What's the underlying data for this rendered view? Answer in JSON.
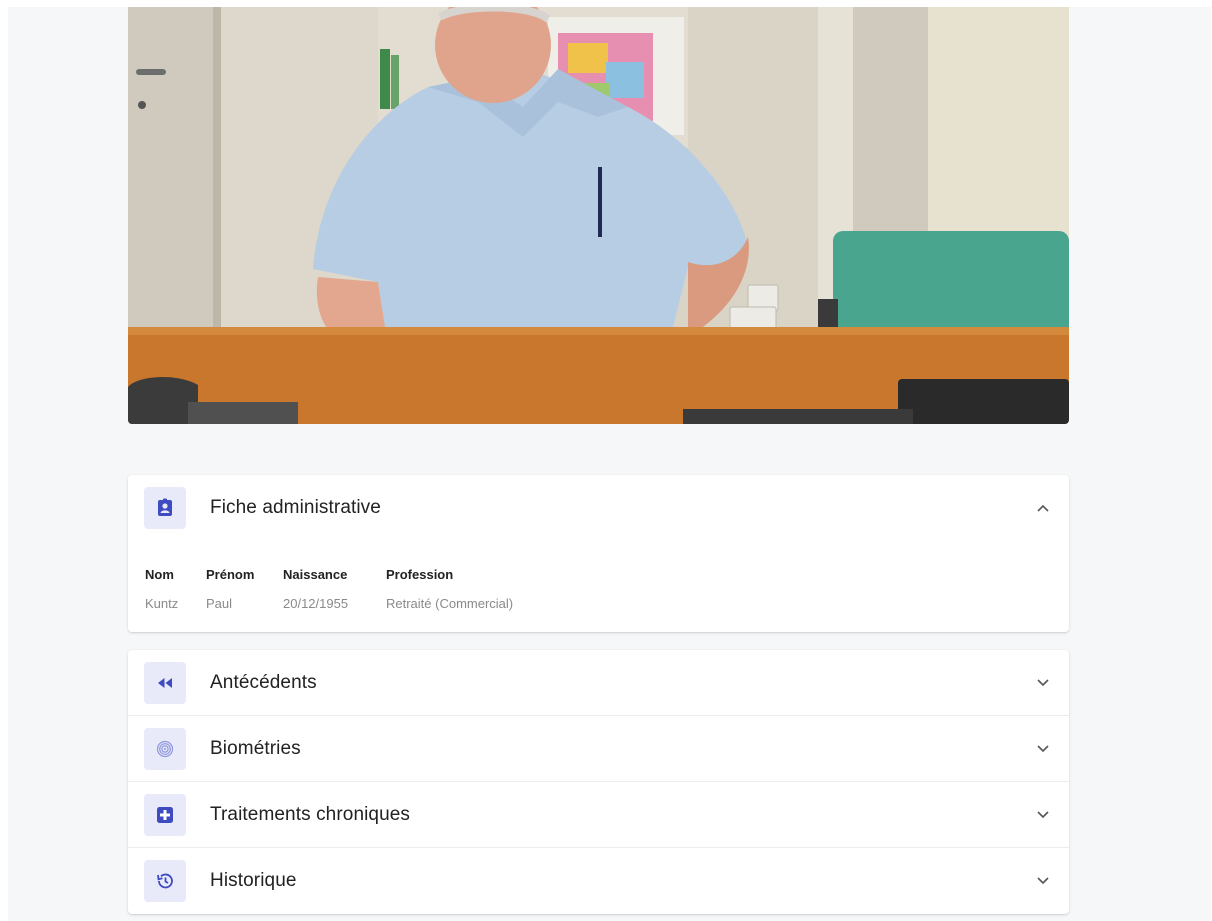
{
  "admin": {
    "title": "Fiche administrative",
    "icon": "contact-badge-icon",
    "expanded": true,
    "fields": [
      {
        "label": "Nom",
        "value": "Kuntz"
      },
      {
        "label": "Prénom",
        "value": "Paul"
      },
      {
        "label": "Naissance",
        "value": "20/12/1955"
      },
      {
        "label": "Profession",
        "value": "Retraité (Commercial)"
      }
    ]
  },
  "sections": [
    {
      "title": "Antécédents",
      "icon": "rewind-icon"
    },
    {
      "title": "Biométries",
      "icon": "fingerprint-icon"
    },
    {
      "title": "Traitements chroniques",
      "icon": "medical-plus-icon"
    },
    {
      "title": "Historique",
      "icon": "history-icon"
    }
  ],
  "colors": {
    "accent": "#3f4bc0",
    "icon_bg": "#e8eafa",
    "page_bg": "#f6f7f9"
  }
}
